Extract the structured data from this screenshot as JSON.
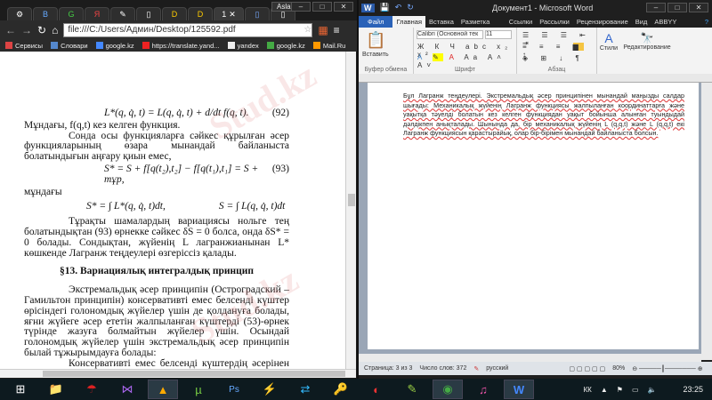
{
  "browser": {
    "user": "Aslan",
    "tabs": [
      "⚙",
      "B",
      "G",
      "Я",
      "✎",
      "▯",
      "D",
      "D",
      "1",
      "▯",
      "▯"
    ],
    "url": "file:///C:/Users/Админ/Desktop/125592.pdf",
    "bookmarks": [
      "Сервисы",
      "Словари",
      "google.kz",
      "https://translate.yand...",
      "yandex",
      "google.kz",
      "Mail.Ru"
    ]
  },
  "pdf": {
    "eq92": "L*(q, q̇, t) = L(q, q̇, t) + d/dt f(q, t).",
    "eq92_num": "(92)",
    "p1": "Мұндағы, f(q,t)  кез келген функция.",
    "p2": "Сонда осы функцияларға сәйкес құрылған әсер функцияларының өзара мынандай байланыста болатындығын аңғару қиын емес,",
    "eq93": "S* = S + f[q(t₂),t₂] − f[q(t₁),t₁] = S + тұр,",
    "eq93_num": "(93)",
    "p3": "мұндағы",
    "eq_int1": "S* = ∫ L*(q, q̇, t)dt,",
    "eq_int2": "S = ∫ L(q, q̇, t)dt",
    "p4": "Тұрақты шамалардың вариациясы нольге тең болатындықтан (93) өрнекке сәйкес δS = 0 болса, онда δS* = 0 болады. Сондықтан, жүйенің L лагранжианынан L* көшкенде Лагранж теңдеулері өзгеріссіз қалады.",
    "heading": "§13. Вариациялық интегралдық принцип",
    "p5": "Экстремальдық әсер принципін (Остроградский – Гамильтон принципін) консервативті емес белсенді күштер өрісіндегі голономдық жүйелер үшін де қолдануға болады, яғни жүйеге әсер ететін жалпыланған күштерді (53)-өрнек түрінде жазуға болмайтын жүйелер үшін. Осындай голономдық жүйелер үшін экстремальдық әсер принципін былай тұжырымдауға болады:",
    "p6": "Консервативті емес белсенді күштердің әсерінен механикалық жүйенің шын орын ауыстыруы, жүйенің кинетикалық энергиясының"
  },
  "word": {
    "title": "Документ1 - Microsoft Word",
    "tabs": [
      "Файл",
      "Главная",
      "Вставка",
      "Разметка страниц",
      "Ссылки",
      "Рассылки",
      "Рецензирование",
      "Вид",
      "ABBYY FineReader"
    ],
    "font_name": "Calibri (Основной тек",
    "font_size": "11",
    "paste": "Вставить",
    "styles": "Стили",
    "editing": "Редактирование",
    "groups": [
      "Буфер обмена",
      "Шрифт",
      "Абзац"
    ],
    "doc_text": "Бұл Лагранж теңдеулері. Экстремальдық әсер принципінен мынандай маңызды салдар шығады: Механикалық жүйенің Лагранж функциясы жалпыланған координаттарға және уақытқа тәуелді болатын кез келген функциядан уақыт бойынша алынған туындыдай дәлдікпен анықталады. Шынында да, бір механикалық жүйенің L (q,q,t) және L (q,q,t) екі Лагранж функциясын қарастырайық, олар бір-бірімен мынандай байланыста болсын.",
    "status": {
      "page": "Страница: 3 из 3",
      "words": "Число слов: 372",
      "lang": "русский",
      "zoom": "80%"
    }
  },
  "taskbar": {
    "lang": "КК",
    "time": "23:25"
  },
  "watermark": "Stud.kz"
}
